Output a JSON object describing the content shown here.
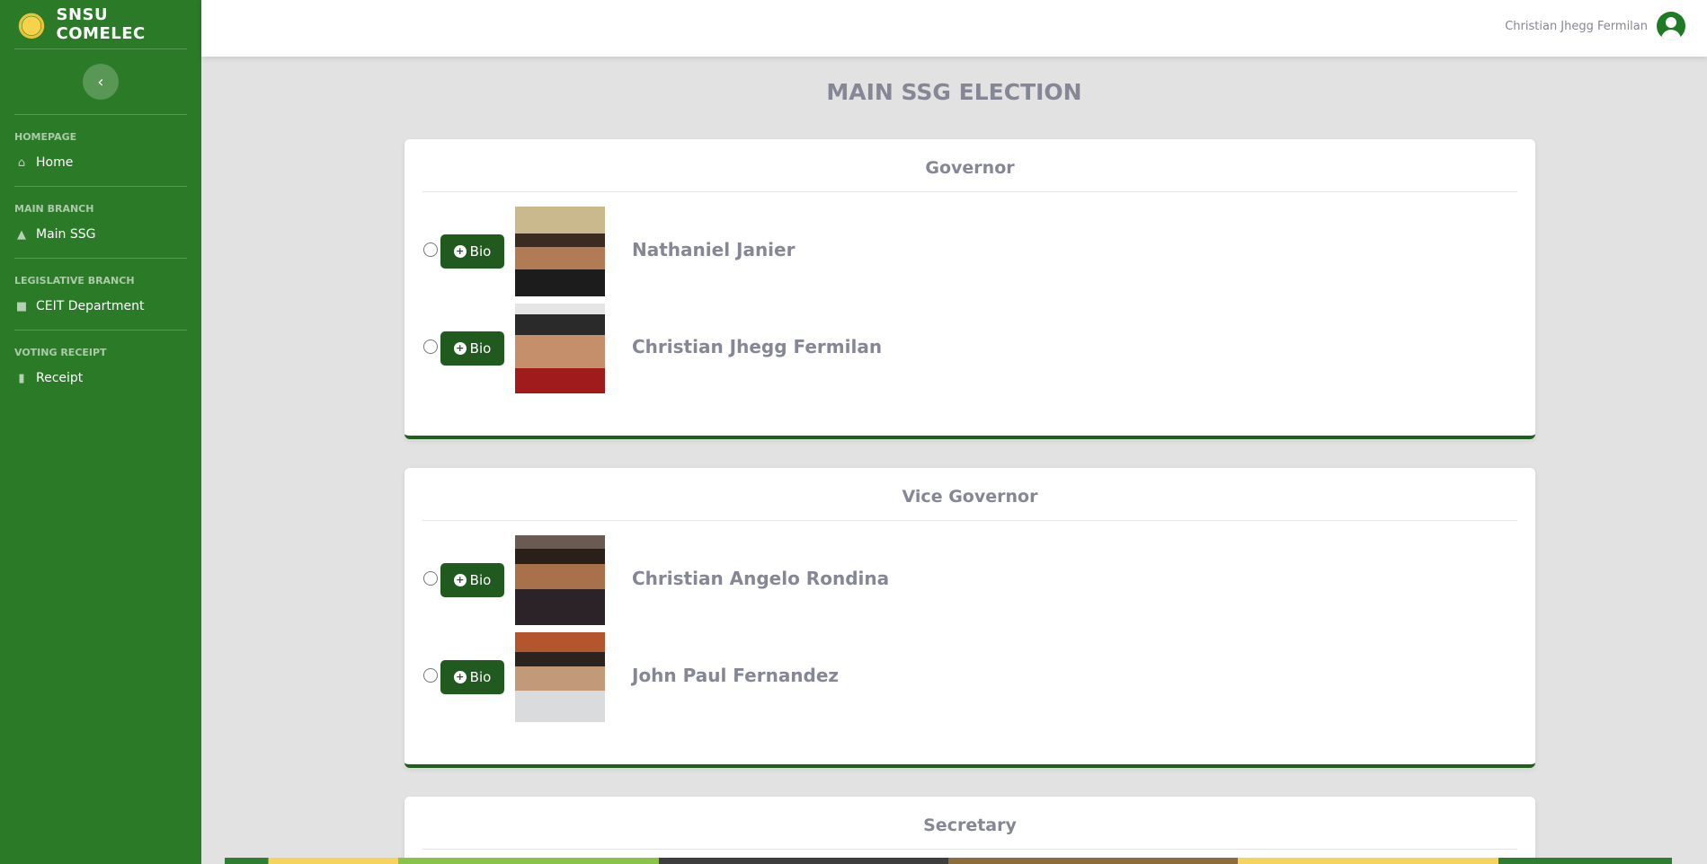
{
  "brand": {
    "title": "SNSU COMELEC",
    "logo_icon": "seal-logo"
  },
  "sidebar": {
    "toggle_icon": "chevron-left-icon",
    "sections": [
      {
        "heading": "HOMEPAGE",
        "item": {
          "label": "Home",
          "icon": "home-icon"
        }
      },
      {
        "heading": "MAIN BRANCH",
        "item": {
          "label": "Main SSG",
          "icon": "landmark-icon"
        }
      },
      {
        "heading": "LEGISLATIVE BRANCH",
        "item": {
          "label": "CEIT Department",
          "icon": "building-icon"
        }
      },
      {
        "heading": "VOTING RECEIPT",
        "item": {
          "label": "Receipt",
          "icon": "receipt-icon"
        }
      }
    ]
  },
  "topbar": {
    "user_name": "Christian Jhegg Fermilan",
    "avatar_icon": "user-circle-icon"
  },
  "page": {
    "title": "MAIN SSG ELECTION"
  },
  "positions": [
    {
      "title": "Governor",
      "candidates": [
        {
          "name": "Nathaniel Janier",
          "bio_label": "Bio"
        },
        {
          "name": "Christian Jhegg Fermilan",
          "bio_label": "Bio"
        }
      ]
    },
    {
      "title": "Vice Governor",
      "candidates": [
        {
          "name": "Christian Angelo Rondina",
          "bio_label": "Bio"
        },
        {
          "name": "John Paul Fernandez",
          "bio_label": "Bio"
        }
      ]
    },
    {
      "title": "Secretary",
      "candidates": []
    }
  ],
  "colors": {
    "sidebar": "#2b7a28",
    "button": "#215a1e",
    "card_border": "#1f5e1c",
    "text_muted": "#858796"
  }
}
